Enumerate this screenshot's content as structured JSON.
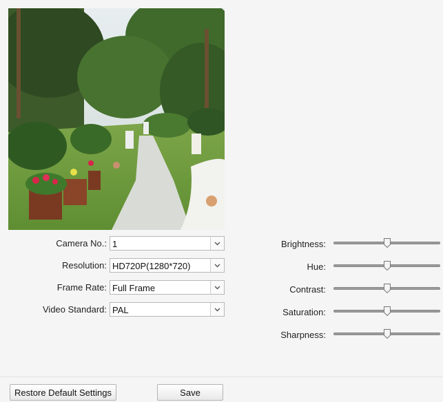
{
  "form": {
    "camera_no": {
      "label": "Camera No.:",
      "value": "1"
    },
    "resolution": {
      "label": "Resolution:",
      "value": "HD720P(1280*720)"
    },
    "frame_rate": {
      "label": "Frame Rate:",
      "value": "Full Frame"
    },
    "video_standard": {
      "label": "Video Standard:",
      "value": "PAL"
    }
  },
  "image_settings": [
    {
      "label": "Brightness:",
      "level": 0.5
    },
    {
      "label": "Hue:",
      "level": 0.5
    },
    {
      "label": "Contrast:",
      "level": 0.5
    },
    {
      "label": "Saturation:",
      "level": 0.5
    },
    {
      "label": "Sharpness:",
      "level": 0.5
    }
  ],
  "buttons": {
    "restore_label": "Restore Default Settings",
    "save_label": "Save"
  },
  "icons": {
    "dropdown": "chevron-down-icon",
    "slider_thumb": "slider-thumb"
  },
  "colors": {
    "background": "#f5f5f5",
    "track": "#9a9a9a",
    "border": "#b7b7b7"
  }
}
